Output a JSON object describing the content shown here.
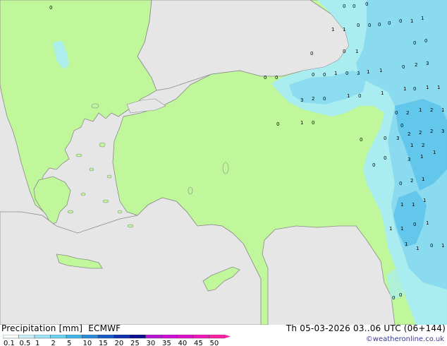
{
  "title": {
    "variable": "Precipitation [mm]",
    "model": "ECMWF"
  },
  "valid_time": "Th 05-03-2026 03..06 UTC (06+144)",
  "credit": "©weatheronline.co.uk",
  "legend": {
    "labels": [
      "0.1",
      "0.5",
      "1",
      "2",
      "5",
      "10",
      "15",
      "20",
      "25",
      "30",
      "35",
      "40",
      "45",
      "50"
    ],
    "colors": [
      "#f7fdf7",
      "#c8f0f8",
      "#9ee3f5",
      "#6fd0f0",
      "#3fb4e8",
      "#2a8ad8",
      "#1a5cc6",
      "#0f30b0",
      "#0a1090",
      "#b818d6",
      "#d010d8",
      "#e010c8",
      "#f018b8",
      "#ff20a8"
    ]
  },
  "map_colors": {
    "sea": "#e6e6e6",
    "land": "#bff79a",
    "coast": "#8a8a8a",
    "precip_light": "#a8ecf4",
    "precip_mid": "#86d8f0",
    "precip_heavy": "#5cc2ea"
  },
  "values": [
    {
      "t": "0"
    },
    {
      "t": "0"
    },
    {
      "t": "0"
    },
    {
      "t": "0"
    },
    {
      "t": "1"
    },
    {
      "t": "1"
    },
    {
      "t": "0"
    },
    {
      "t": "0"
    },
    {
      "t": "0"
    },
    {
      "t": "0"
    },
    {
      "t": "0"
    },
    {
      "t": "1"
    },
    {
      "t": "1"
    },
    {
      "t": "0"
    },
    {
      "t": "1"
    },
    {
      "t": "0"
    },
    {
      "t": "0"
    },
    {
      "t": "0"
    },
    {
      "t": "0"
    },
    {
      "t": "0"
    },
    {
      "t": "0"
    },
    {
      "t": "0"
    },
    {
      "t": "1"
    },
    {
      "t": "3"
    },
    {
      "t": "1"
    },
    {
      "t": "1"
    },
    {
      "t": "2"
    },
    {
      "t": "3"
    },
    {
      "t": "0"
    },
    {
      "t": "0"
    },
    {
      "t": "3"
    },
    {
      "t": "2"
    },
    {
      "t": "0"
    },
    {
      "t": "1"
    },
    {
      "t": "1"
    },
    {
      "t": "0"
    },
    {
      "t": "0"
    },
    {
      "t": "1"
    },
    {
      "t": "1"
    },
    {
      "t": "1"
    },
    {
      "t": "0"
    },
    {
      "t": "1"
    },
    {
      "t": "0"
    },
    {
      "t": "0"
    },
    {
      "t": "2"
    },
    {
      "t": "2"
    },
    {
      "t": "1"
    },
    {
      "t": "1"
    },
    {
      "t": "0"
    },
    {
      "t": "3"
    },
    {
      "t": "2"
    },
    {
      "t": "2"
    },
    {
      "t": "2"
    },
    {
      "t": "3"
    },
    {
      "t": "0"
    },
    {
      "t": "0"
    },
    {
      "t": "1"
    },
    {
      "t": "2"
    },
    {
      "t": "1"
    },
    {
      "t": "0"
    },
    {
      "t": "3"
    },
    {
      "t": "1"
    },
    {
      "t": "0"
    },
    {
      "t": "2"
    },
    {
      "t": "1"
    },
    {
      "t": "0"
    },
    {
      "t": "1"
    },
    {
      "t": "1"
    },
    {
      "t": "1"
    },
    {
      "t": "1"
    },
    {
      "t": "0"
    },
    {
      "t": "1"
    },
    {
      "t": "1"
    },
    {
      "t": "1"
    },
    {
      "t": "1"
    },
    {
      "t": "0"
    },
    {
      "t": "1"
    },
    {
      "t": "0"
    },
    {
      "t": "0"
    }
  ]
}
